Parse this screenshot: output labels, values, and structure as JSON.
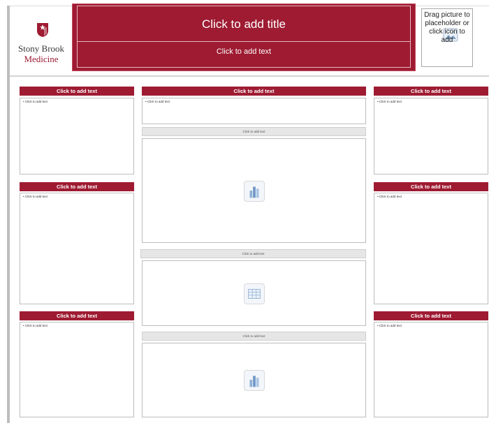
{
  "header": {
    "logo": {
      "line1": "Stony Brook",
      "line2": "Medicine"
    },
    "title": "Click to add title",
    "subtitle": "Click to add text",
    "picture_placeholder": "Drag picture to placeholder or click icon to add"
  },
  "left_column": [
    {
      "heading": "Click to add text",
      "bullet": "Click to add text"
    },
    {
      "heading": "Click to add text",
      "bullet": "Click to add text"
    },
    {
      "heading": "Click to add text",
      "bullet": "Click to add text"
    }
  ],
  "center_column": {
    "heading": "Click to add text",
    "bullet": "Click to add text",
    "captions": [
      "Click to add text",
      "Click to add text",
      "Click to add text"
    ],
    "placeholders": [
      {
        "icon": "chart-icon"
      },
      {
        "icon": "table-icon"
      },
      {
        "icon": "chart-icon"
      }
    ]
  },
  "right_column": [
    {
      "heading": "Click to add text",
      "bullet": "Click to add text"
    },
    {
      "heading": "Click to add text",
      "bullet": "Click to add text"
    },
    {
      "heading": "Click to add text",
      "bullet": "Click to add text"
    }
  ],
  "colors": {
    "brand": "#9e1b32",
    "frame": "#bdbdbd",
    "caption": "#e6e6e6"
  }
}
